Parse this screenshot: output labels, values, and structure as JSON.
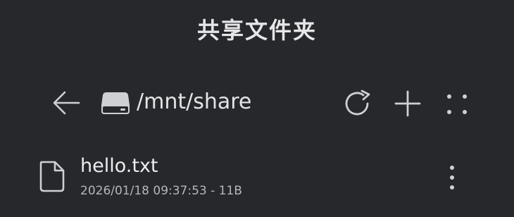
{
  "header": {
    "title": "共享文件夹"
  },
  "toolbar": {
    "back_icon": "arrow-left-icon",
    "drive_icon": "storage-drive-icon",
    "path": "/mnt/share",
    "refresh_icon": "refresh-icon",
    "add_icon": "plus-icon",
    "more_icon": "grid-dots-icon"
  },
  "files": [
    {
      "icon": "file-icon",
      "name": "hello.txt",
      "meta": "2026/01/18 09:37:53 - 11B",
      "menu_icon": "vertical-dots-icon"
    }
  ],
  "colors": {
    "background": "#27282c",
    "text_primary": "#e8e8ea",
    "text_secondary": "#b5b6ba",
    "icon": "#d0d0d3"
  }
}
